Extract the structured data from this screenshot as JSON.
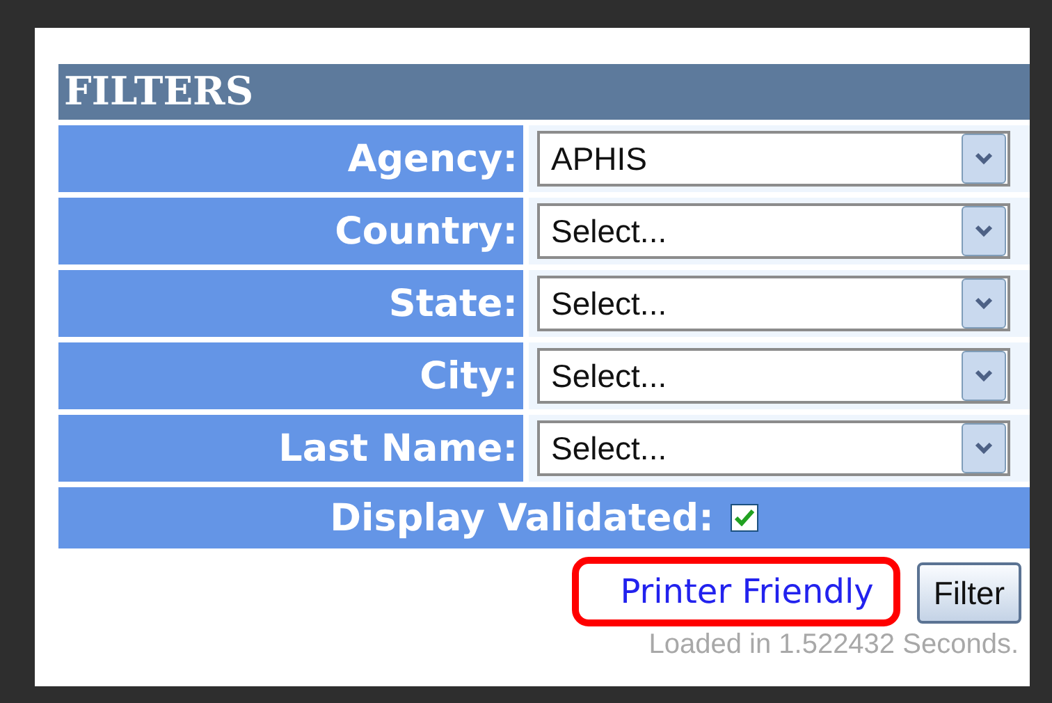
{
  "title": "FILTERS",
  "filters": [
    {
      "label": "Agency:",
      "value": "APHIS"
    },
    {
      "label": "Country:",
      "value": "Select..."
    },
    {
      "label": "State:",
      "value": "Select..."
    },
    {
      "label": "City:",
      "value": "Select..."
    },
    {
      "label": "Last Name:",
      "value": "Select..."
    }
  ],
  "display_validated": {
    "label": "Display Validated:",
    "checked": true
  },
  "printer_link": {
    "label": "Printer Friendly",
    "highlighted": true
  },
  "filter_button": "Filter",
  "load_time": "Loaded in 1.522432 Seconds."
}
